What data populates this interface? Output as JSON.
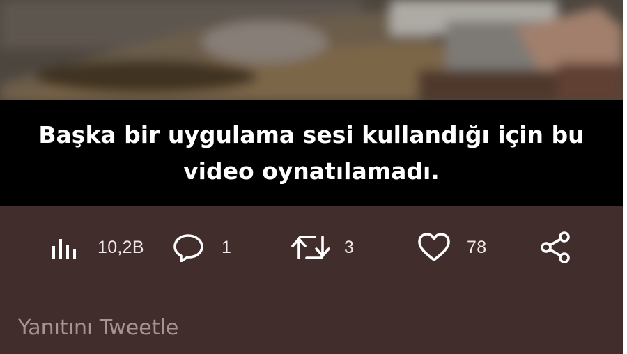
{
  "video": {
    "error_message": "Başka bir uygulama sesi kullandığı için bu video oynatılamadı."
  },
  "actions": {
    "views": {
      "icon": "views-chart-icon",
      "count": "10,2B"
    },
    "replies": {
      "icon": "comment-bubble-icon",
      "count": "1"
    },
    "retweets": {
      "icon": "retweet-icon",
      "count": "3"
    },
    "likes": {
      "icon": "heart-icon",
      "count": "78"
    },
    "share": {
      "icon": "share-icon"
    }
  },
  "reply": {
    "placeholder": "Yanıtını Tweetle"
  },
  "colors": {
    "background": "#422d2d",
    "overlay": "#000000",
    "text": "#ffffff",
    "placeholder": "#a69393"
  }
}
